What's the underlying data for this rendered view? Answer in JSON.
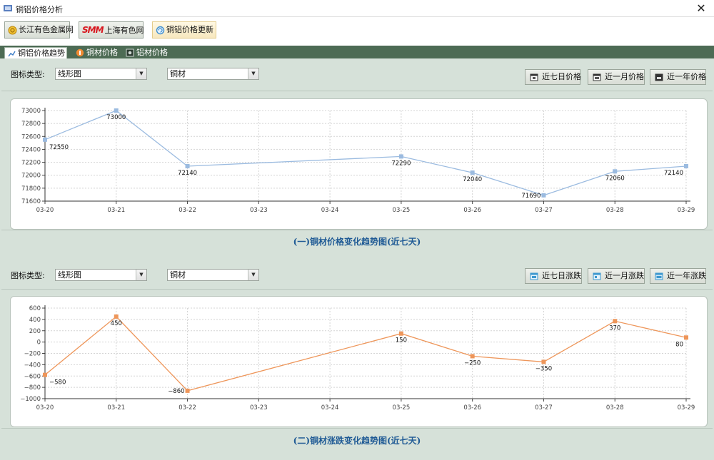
{
  "window": {
    "title": "铜铝价格分析",
    "close_glyph": "✕"
  },
  "toolbar": {
    "buttons": [
      {
        "label": "长江有色金属网"
      },
      {
        "logo_text": "SMM",
        "label": "上海有色网"
      },
      {
        "label": "铜铝价格更新"
      }
    ]
  },
  "tabs": [
    {
      "label": "铜铝价格趋势"
    },
    {
      "label": "铜材价格"
    },
    {
      "label": "铝材价格"
    }
  ],
  "panel1": {
    "chart_type_label": "图标类型:",
    "chart_type_value": "线形图",
    "material_value": "铜材",
    "buttons": [
      "近七日价格",
      "近一月价格",
      "近一年价格"
    ],
    "caption": "(一)铜材价格变化趋势图(近七天)"
  },
  "panel2": {
    "chart_type_label": "图标类型:",
    "chart_type_value": "线形图",
    "material_value": "铜材",
    "buttons": [
      "近七日涨跌",
      "近一月涨跌",
      "近一年涨跌"
    ],
    "caption": "(二)铜材涨跌变化趋势图(近七天)"
  },
  "chart_data": [
    {
      "type": "line",
      "color": "#9bbbe0",
      "x_categories": [
        "03-20",
        "03-21",
        "03-22",
        "03-23",
        "03-24",
        "03-25",
        "03-26",
        "03-27",
        "03-28",
        "03-29"
      ],
      "points": [
        {
          "x": "03-20",
          "y": 72550
        },
        {
          "x": "03-21",
          "y": 73000
        },
        {
          "x": "03-22",
          "y": 72140
        },
        {
          "x": "03-25",
          "y": 72290
        },
        {
          "x": "03-26",
          "y": 72040
        },
        {
          "x": "03-27",
          "y": 71690
        },
        {
          "x": "03-28",
          "y": 72060
        },
        {
          "x": "03-29",
          "y": 72140
        }
      ],
      "ylim": [
        71600,
        73000
      ],
      "yticks": [
        71600,
        71800,
        72000,
        72200,
        72400,
        72600,
        72800,
        73000
      ],
      "grid": true
    },
    {
      "type": "line",
      "color": "#ee965a",
      "x_categories": [
        "03-20",
        "03-21",
        "03-22",
        "03-23",
        "03-24",
        "03-25",
        "03-26",
        "03-27",
        "03-28",
        "03-29"
      ],
      "points": [
        {
          "x": "03-20",
          "y": -580
        },
        {
          "x": "03-21",
          "y": 450
        },
        {
          "x": "03-22",
          "y": -860
        },
        {
          "x": "03-25",
          "y": 150
        },
        {
          "x": "03-26",
          "y": -250
        },
        {
          "x": "03-27",
          "y": -350
        },
        {
          "x": "03-28",
          "y": 370
        },
        {
          "x": "03-29",
          "y": 80
        }
      ],
      "ylim": [
        -1000,
        600
      ],
      "yticks": [
        -1000,
        -800,
        -600,
        -400,
        -200,
        0,
        200,
        400,
        600
      ],
      "grid": true
    }
  ]
}
